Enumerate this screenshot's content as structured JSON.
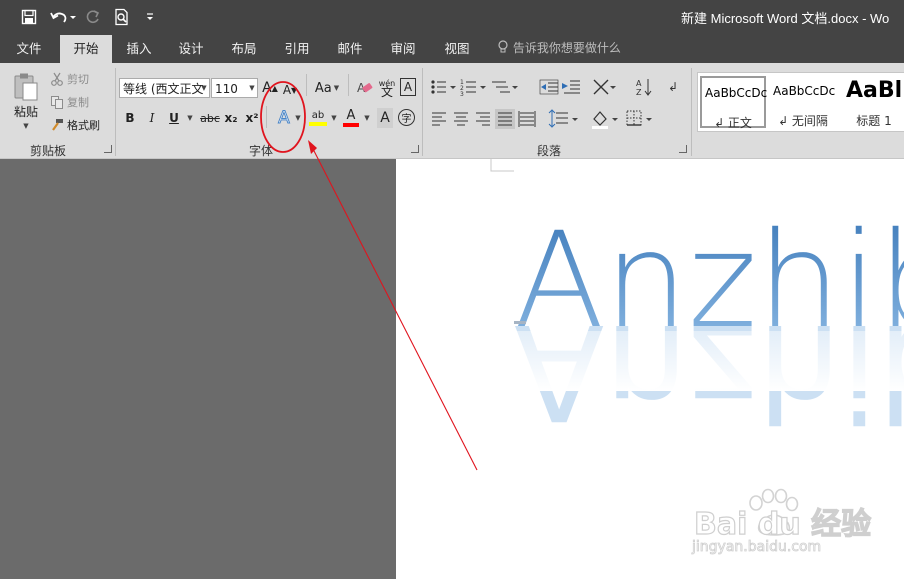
{
  "window": {
    "title": "新建 Microsoft Word 文档.docx  -  Wo"
  },
  "quick_access": {
    "save_icon": "save-icon",
    "undo_icon": "undo-icon",
    "redo_icon": "redo-icon",
    "preview_icon": "print-preview-icon",
    "customize_icon": "customize-qat-icon"
  },
  "tabs": [
    {
      "label": "文件",
      "active": false
    },
    {
      "label": "开始",
      "active": true
    },
    {
      "label": "插入",
      "active": false
    },
    {
      "label": "设计",
      "active": false
    },
    {
      "label": "布局",
      "active": false
    },
    {
      "label": "引用",
      "active": false
    },
    {
      "label": "邮件",
      "active": false
    },
    {
      "label": "审阅",
      "active": false
    },
    {
      "label": "视图",
      "active": false
    }
  ],
  "tell_me": "告诉我你想要做什么",
  "clipboard": {
    "paste": "粘贴",
    "cut": "剪切",
    "copy": "复制",
    "format_painter": "格式刷",
    "group_label": "剪贴板"
  },
  "font": {
    "font_name": "等线 (西文正文",
    "font_size": "110",
    "grow": "A",
    "shrink": "A",
    "change_case": "Aa",
    "phonetic": "wén",
    "char_border": "A",
    "bold": "B",
    "italic": "I",
    "underline": "U",
    "strikethrough": "abc",
    "subscript": "x₂",
    "superscript": "x²",
    "text_effects": "A",
    "highlight": "ab",
    "font_color": "A",
    "char_shading": "A",
    "enclose": "字",
    "group_label": "字体"
  },
  "paragraph": {
    "group_label": "段落"
  },
  "styles": [
    {
      "preview": "AaBbCcDc",
      "name": "↲ 正文"
    },
    {
      "preview": "AaBbCcDc",
      "name": "↲ 无间隔"
    },
    {
      "preview": "AaBl",
      "name": "标题 1"
    }
  ],
  "document": {
    "text": "Anzhib"
  },
  "watermark": {
    "brand": "Bai du 经验",
    "url": "jingyan.baidu.com"
  },
  "colors": {
    "title_bar": "#444444",
    "ribbon": "#dcdcdc",
    "workspace": "#6b6b6b",
    "annotation_red": "#e0141e",
    "highlight_yellow": "#ffff00",
    "font_color_red": "#ff0000",
    "text_effect_blue": "#4a86c8"
  }
}
